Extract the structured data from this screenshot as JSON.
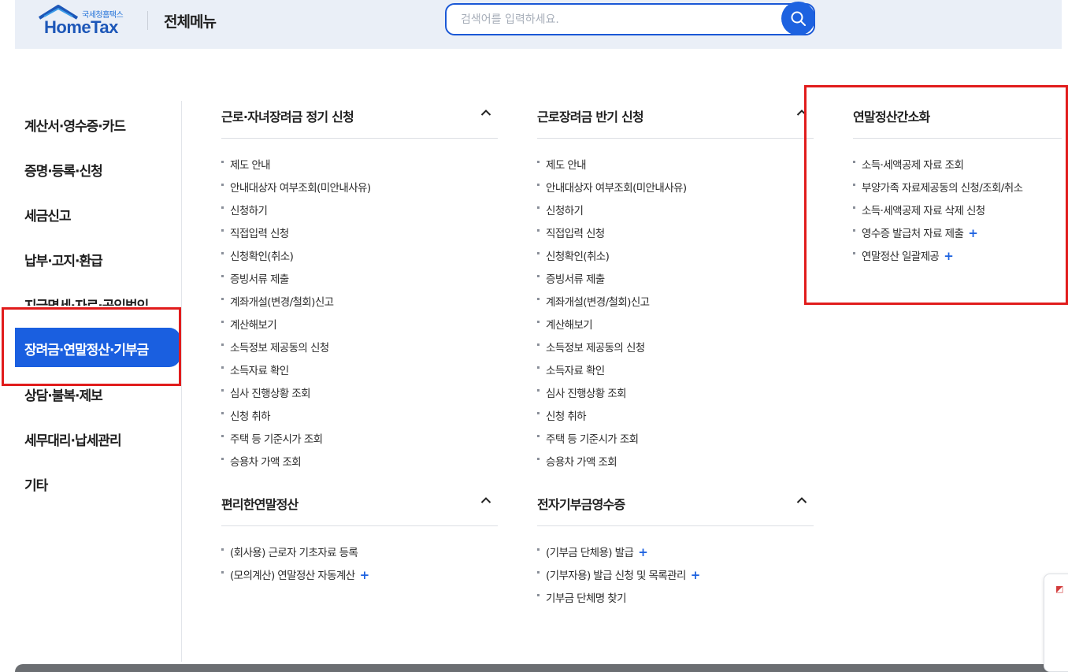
{
  "header": {
    "logo_kr": "국세청홈택스",
    "logo_en": "HomeTax",
    "menu_title": "전체메뉴",
    "search_placeholder": "검색어를 입력하세요."
  },
  "leftnav": {
    "items": [
      "계산서·영수증·카드",
      "증명·등록·신청",
      "세금신고",
      "납부·고지·환급",
      "지급명세·자료·공익법인",
      "장려금·연말정산·기부금",
      "상담·불복·제보",
      "세무대리·납세관리",
      "기타"
    ],
    "active_index": 5
  },
  "sections": {
    "col1_top": {
      "title": "근로·자녀장려금 정기 신청",
      "links": [
        "제도 안내",
        "안내대상자 여부조회(미안내사유)",
        "신청하기",
        "직접입력 신청",
        "신청확인(취소)",
        "증빙서류 제출",
        "계좌개설(변경/철회)신고",
        "계산해보기",
        "소득정보 제공동의 신청",
        "소득자료 확인",
        "심사 진행상황 조회",
        "신청 취하",
        "주택 등 기준시가 조회",
        "승용차 가액 조회"
      ]
    },
    "col2_top": {
      "title": "근로장려금 반기 신청",
      "links": [
        "제도 안내",
        "안내대상자 여부조회(미안내사유)",
        "신청하기",
        "직접입력 신청",
        "신청확인(취소)",
        "증빙서류 제출",
        "계좌개설(변경/철회)신고",
        "계산해보기",
        "소득정보 제공동의 신청",
        "소득자료 확인",
        "심사 진행상황 조회",
        "신청 취하",
        "주택 등 기준시가 조회",
        "승용차 가액 조회"
      ]
    },
    "col3_top": {
      "title": "연말정산간소화",
      "links": [
        "소득·세액공제 자료 조회",
        "부양가족 자료제공동의 신청/조회/취소",
        "소득·세액공제 자료 삭제 신청",
        "영수증 발급처 자료 제출",
        "연말정산 일괄제공"
      ],
      "plus_flags": [
        false,
        false,
        false,
        true,
        true
      ]
    },
    "col1_bottom": {
      "title": "편리한연말정산",
      "links": [
        "(회사용) 근로자 기초자료 등록",
        "(모의계산) 연말정산 자동계산"
      ],
      "plus_flags": [
        false,
        true
      ]
    },
    "col2_bottom": {
      "title": "전자기부금영수증",
      "links": [
        "(기부금 단체용) 발급",
        "(기부자용) 발급 신청 및 목록관리",
        "기부금 단체명 찾기"
      ],
      "plus_flags": [
        true,
        true,
        false
      ]
    }
  },
  "plus_symbol": "+",
  "colors": {
    "accent": "#1a5fe0",
    "highlight": "#e11c1c",
    "header_bg": "#eaeff7"
  }
}
